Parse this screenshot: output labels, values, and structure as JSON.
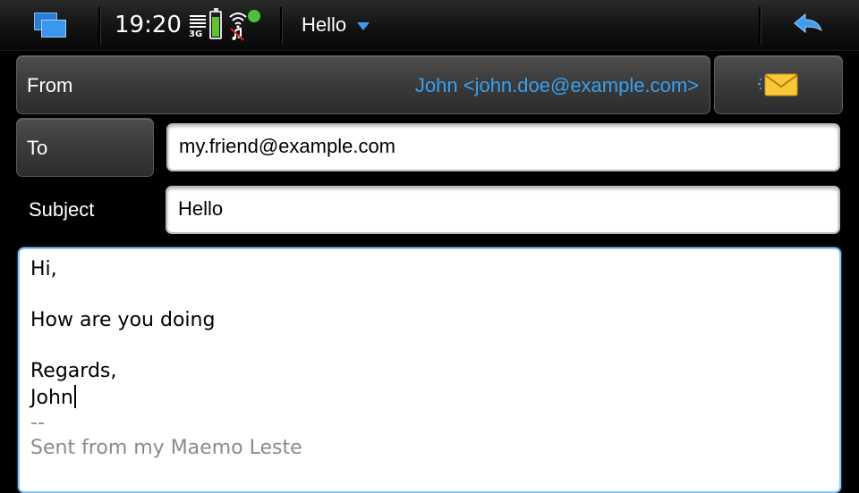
{
  "status_bar": {
    "time": "19:20",
    "network": "3G",
    "battery_level": 0.78,
    "presence_color": "#4cc23a"
  },
  "header": {
    "title": "Hello",
    "accent_color": "#3b9ef0",
    "icons": [
      "task-switcher-icon",
      "signal-icon",
      "battery-icon",
      "wifi-icon",
      "music-muted-icon",
      "presence-icon",
      "menu-arrow-icon",
      "back-icon"
    ]
  },
  "compose": {
    "from_label": "From",
    "from_value": "John <john.doe@example.com>",
    "to_label": "To",
    "to_value": "my.friend@example.com",
    "subject_label": "Subject",
    "subject_value": "Hello",
    "send_icon": "envelope-send-icon",
    "body_lines": [
      "Hi,",
      "",
      "How are you doing",
      "",
      "Regards,",
      "John"
    ],
    "signature_lines": [
      "--",
      "Sent from my Maemo Leste"
    ]
  }
}
